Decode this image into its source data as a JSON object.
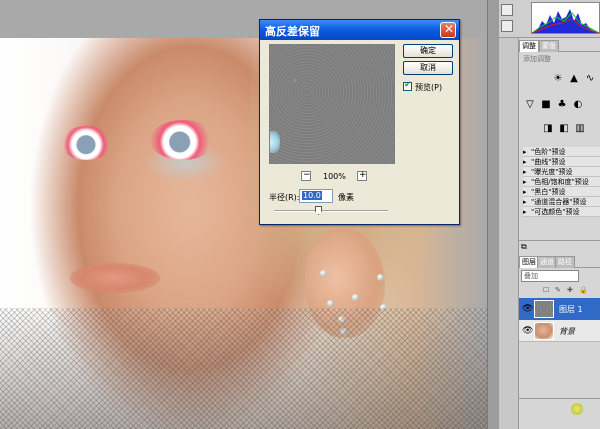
{
  "dialog": {
    "title": "高反差保留",
    "close_glyph": "✕",
    "ok_label": "确定",
    "cancel_label": "取消",
    "preview_label": "预览(P)",
    "preview_checked": true,
    "zoom_out_glyph": "−",
    "zoom_in_glyph": "+",
    "zoom_level": "100%",
    "radius_label": "半径(R):",
    "radius_value": "10.0",
    "radius_unit": "像素"
  },
  "adjustments_panel": {
    "tab_adjust": "调整",
    "tab_mask": "蒙版",
    "subtitle": "添加调整",
    "icons": [
      "brightness-icon",
      "levels-icon",
      "curves-icon",
      "exposure-icon",
      "vibrance-icon",
      "hue-icon",
      "balance-icon",
      "bw-icon"
    ],
    "presets": [
      "\"色阶\"预设",
      "\"曲线\"预设",
      "\"曝光度\"预设",
      "\"色相/饱和度\"预设",
      "\"黑白\"预设",
      "\"通道混合器\"预设",
      "\"可选颜色\"预设"
    ]
  },
  "layers_panel": {
    "tab_layers": "图层",
    "tab_channels": "通道",
    "tab_paths": "路径",
    "blend_mode": "叠加",
    "layers": [
      {
        "name": "图层 1",
        "selected": true
      },
      {
        "name": "背景",
        "selected": false
      }
    ]
  },
  "colors": {
    "titlebar": "#0a5be0",
    "selected_layer": "#3169c6",
    "eye_shadow": "#f05a7a"
  }
}
